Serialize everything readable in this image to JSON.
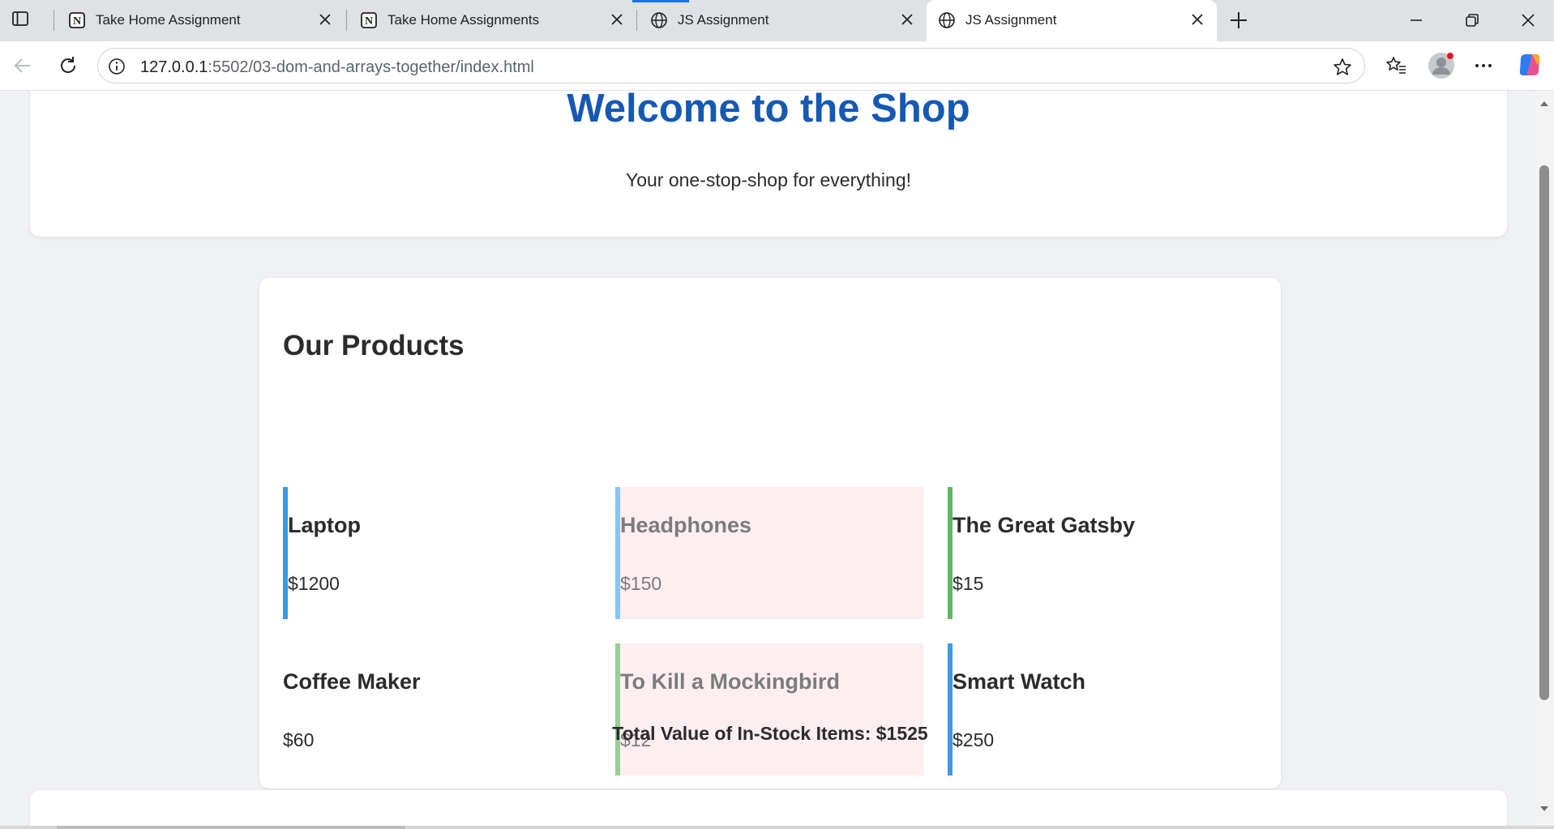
{
  "browser": {
    "tabs": [
      {
        "title": "Take Home Assignment",
        "favicon": "notion-icon",
        "active": false
      },
      {
        "title": "Take Home Assignments",
        "favicon": "notion-icon",
        "active": false
      },
      {
        "title": "JS Assignment",
        "favicon": "globe-icon",
        "active": false
      },
      {
        "title": "JS Assignment",
        "favicon": "globe-icon",
        "active": true
      }
    ],
    "url_host": "127.0.0.1",
    "url_rest": ":5502/03-dom-and-arrays-together/index.html"
  },
  "page": {
    "heading": "Welcome to the Shop",
    "tagline": "Your one-stop-shop for everything!",
    "products_title": "Our Products",
    "products": [
      {
        "name": "Laptop",
        "price": "$1200",
        "in_stock": true,
        "accent": "#3d98e8"
      },
      {
        "name": "Headphones",
        "price": "$150",
        "in_stock": false,
        "accent": "#88c5f2"
      },
      {
        "name": "The Great Gatsby",
        "price": "$15",
        "in_stock": true,
        "accent": "#5fb760"
      },
      {
        "name": "Coffee Maker",
        "price": "$60",
        "in_stock": true,
        "accent": ""
      },
      {
        "name": "To Kill a Mockingbird",
        "price": "$12",
        "in_stock": false,
        "accent": "#96d096"
      },
      {
        "name": "Smart Watch",
        "price": "$250",
        "in_stock": true,
        "accent": "#3d98e8"
      }
    ],
    "total_text": "Total Value of In-Stock Items: $1525"
  },
  "colors": {
    "heading": "#1559b3",
    "out_of_stock_bg": "#fdeef1"
  }
}
